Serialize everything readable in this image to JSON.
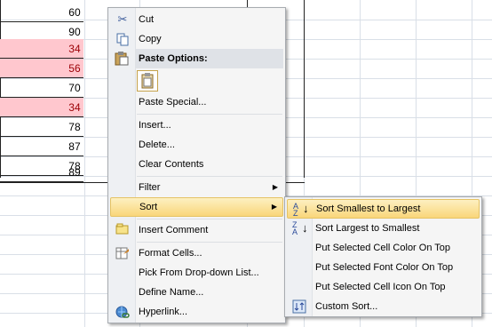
{
  "sheet": {
    "values": [
      {
        "v": "60",
        "red": false
      },
      {
        "v": "90",
        "red": false
      },
      {
        "v": "34",
        "red": true
      },
      {
        "v": "56",
        "red": true
      },
      {
        "v": "70",
        "red": false
      },
      {
        "v": "34",
        "red": true
      },
      {
        "v": "78",
        "red": false
      },
      {
        "v": "87",
        "red": false
      },
      {
        "v": "78",
        "red": false
      },
      {
        "v": "89",
        "red": false
      }
    ]
  },
  "context_menu": {
    "cut": "Cut",
    "copy": "Copy",
    "paste_options": "Paste Options:",
    "paste_special": "Paste Special...",
    "insert": "Insert...",
    "delete": "Delete...",
    "clear_contents": "Clear Contents",
    "filter": "Filter",
    "sort": "Sort",
    "insert_comment": "Insert Comment",
    "format_cells": "Format Cells...",
    "pick_dropdown": "Pick From Drop-down List...",
    "define_name": "Define Name...",
    "hyperlink": "Hyperlink..."
  },
  "sort_submenu": {
    "asc": "Sort Smallest to Largest",
    "desc": "Sort Largest to Smallest",
    "cell_color": "Put Selected Cell Color On Top",
    "font_color": "Put Selected Font Color On Top",
    "cell_icon": "Put Selected Cell Icon On Top",
    "custom": "Custom Sort..."
  },
  "colors": {
    "highlight": "#f9d67a",
    "red_fill": "#ffc7ce",
    "red_text": "#9c0006"
  }
}
